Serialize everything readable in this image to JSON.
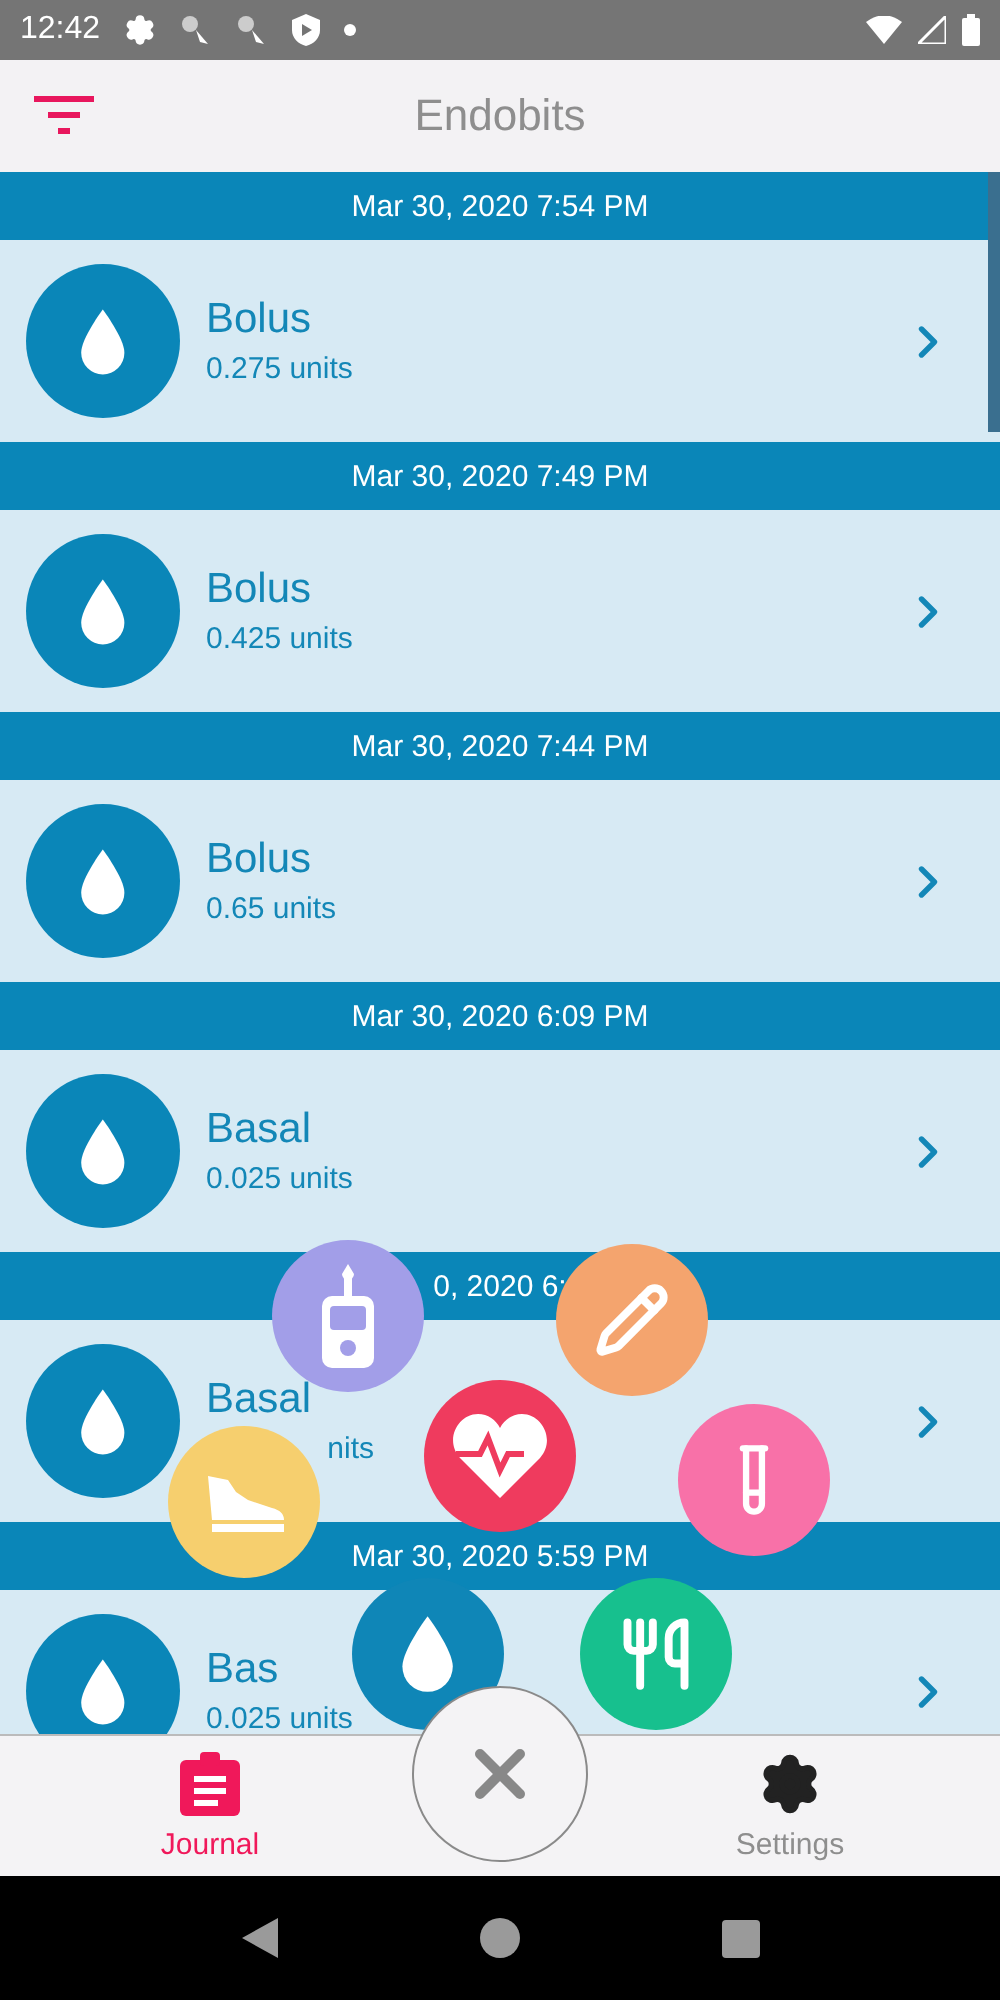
{
  "status_bar": {
    "time": "12:42"
  },
  "app_bar": {
    "title": "Endobits"
  },
  "entries": [
    {
      "date": "Mar 30, 2020 7:54 PM",
      "title": "Bolus",
      "subtitle": "0.275 units",
      "subtitle_cut": false
    },
    {
      "date": "Mar 30, 2020 7:49 PM",
      "title": "Bolus",
      "subtitle": "0.425 units",
      "subtitle_cut": false
    },
    {
      "date": "Mar 30, 2020 7:44 PM",
      "title": "Bolus",
      "subtitle": "0.65 units",
      "subtitle_cut": false
    },
    {
      "date": "Mar 30, 2020 6:09 PM",
      "title": "Basal",
      "subtitle": "0.025 units",
      "subtitle_cut": false
    },
    {
      "date": "0, 2020 6:",
      "title": "Basal",
      "subtitle": "nits",
      "subtitle_cut": true
    },
    {
      "date": "Mar 30, 2020 5:59 PM",
      "title": "Bas",
      "subtitle": "0.025 units",
      "subtitle_cut": false
    }
  ],
  "fab_menu": [
    {
      "kind": "glucometer",
      "color": "#a29ee8"
    },
    {
      "kind": "pencil",
      "color": "#f4a46e"
    },
    {
      "kind": "shoe",
      "color": "#f6cf6e"
    },
    {
      "kind": "heart",
      "color": "#ef3b5e"
    },
    {
      "kind": "test-tube",
      "color": "#f871a8"
    },
    {
      "kind": "drop",
      "color": "#0f86b7"
    },
    {
      "kind": "food",
      "color": "#17c08e"
    }
  ],
  "bottom_nav": [
    {
      "kind": "journal",
      "label": "Journal",
      "selected": true
    },
    {
      "kind": "settings",
      "label": "Settings",
      "selected": false
    }
  ]
}
